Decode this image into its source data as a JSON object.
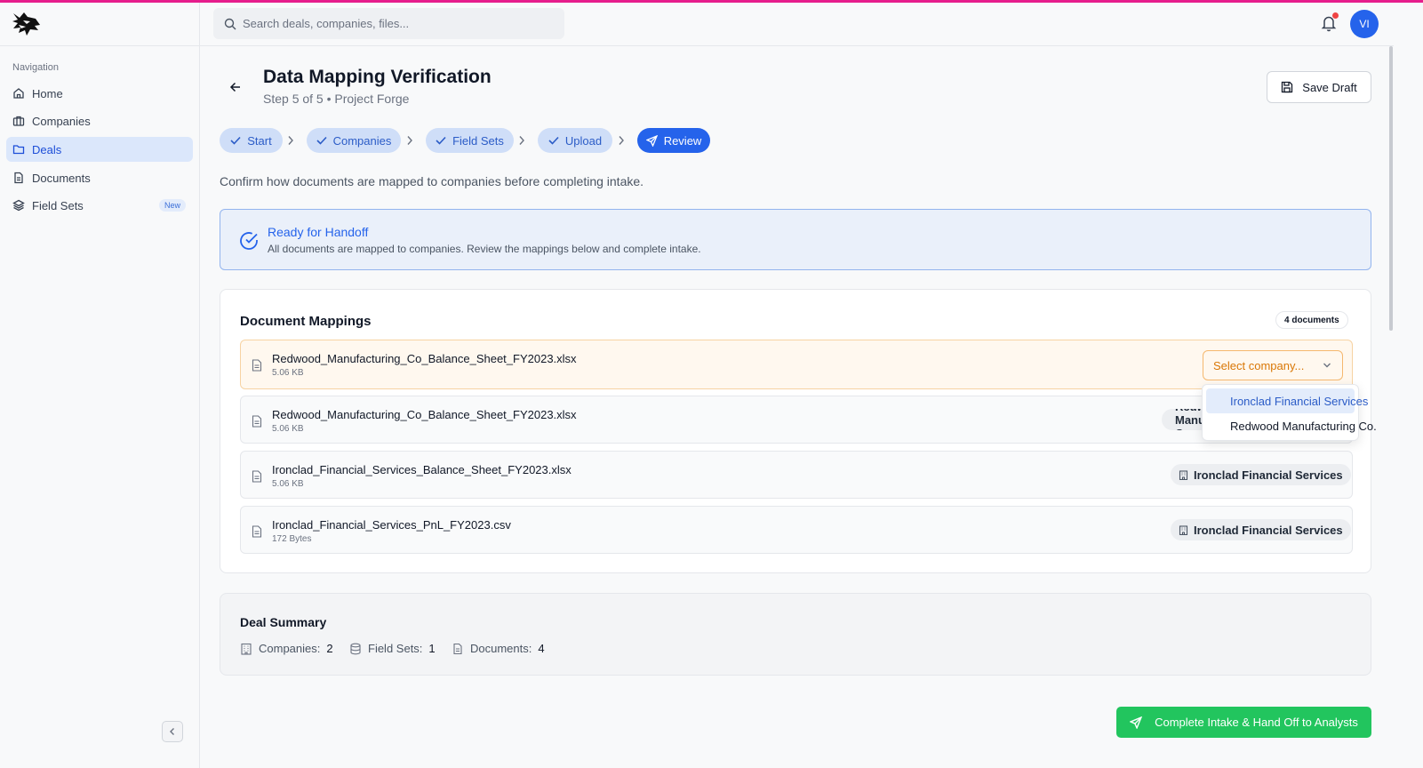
{
  "header": {
    "search_placeholder": "Search deals, companies, files...",
    "avatar_initials": "VI",
    "notification_dot_color": "#ef4444"
  },
  "sidebar": {
    "heading": "Navigation",
    "items": [
      {
        "label": "Home",
        "icon": "home-icon"
      },
      {
        "label": "Companies",
        "icon": "briefcase-icon"
      },
      {
        "label": "Deals",
        "icon": "folder-icon",
        "active": true
      },
      {
        "label": "Documents",
        "icon": "document-icon"
      },
      {
        "label": "Field Sets",
        "icon": "layers-icon",
        "badge": "New"
      }
    ]
  },
  "page": {
    "title": "Data Mapping Verification",
    "subtitle": "Step 5 of 5 • Project Forge",
    "save_draft_label": "Save Draft",
    "intro": "Confirm how documents are mapped to companies before completing intake."
  },
  "steps": [
    {
      "label": "Start",
      "status": "done"
    },
    {
      "label": "Companies",
      "status": "done"
    },
    {
      "label": "Field Sets",
      "status": "done"
    },
    {
      "label": "Upload",
      "status": "done"
    },
    {
      "label": "Review",
      "status": "current"
    }
  ],
  "ready": {
    "title": "Ready for Handoff",
    "text": "All documents are mapped to companies. Review the mappings below and complete intake."
  },
  "mappings": {
    "title": "Document Mappings",
    "count_label": "4 documents",
    "documents": [
      {
        "name": "Redwood_Manufacturing_Co_Balance_Sheet_FY2023.xlsx",
        "size": "5.06 KB",
        "company": "",
        "select_placeholder": "Select company..."
      },
      {
        "name": "Redwood_Manufacturing_Co_Balance_Sheet_FY2023.xlsx",
        "size": "5.06 KB",
        "company": "Redwood Manufacturing Co."
      },
      {
        "name": "Ironclad_Financial_Services_Balance_Sheet_FY2023.xlsx",
        "size": "5.06 KB",
        "company": "Ironclad Financial Services"
      },
      {
        "name": "Ironclad_Financial_Services_PnL_FY2023.csv",
        "size": "172 Bytes",
        "company": "Ironclad Financial Services"
      }
    ],
    "dropdown_options": [
      "Ironclad Financial Services",
      "Redwood Manufacturing Co."
    ]
  },
  "summary": {
    "title": "Deal Summary",
    "stats": [
      {
        "label": "Companies:",
        "value": "2",
        "icon": "building-icon"
      },
      {
        "label": "Field Sets:",
        "value": "1",
        "icon": "database-icon"
      },
      {
        "label": "Documents:",
        "value": "4",
        "icon": "document-icon"
      }
    ]
  },
  "complete_button_label": "Complete Intake & Hand Off to Analysts",
  "colors": {
    "accent": "#2563eb",
    "top_bar": "#e61d8c",
    "success": "#22c55e",
    "warning": "#d97706"
  }
}
